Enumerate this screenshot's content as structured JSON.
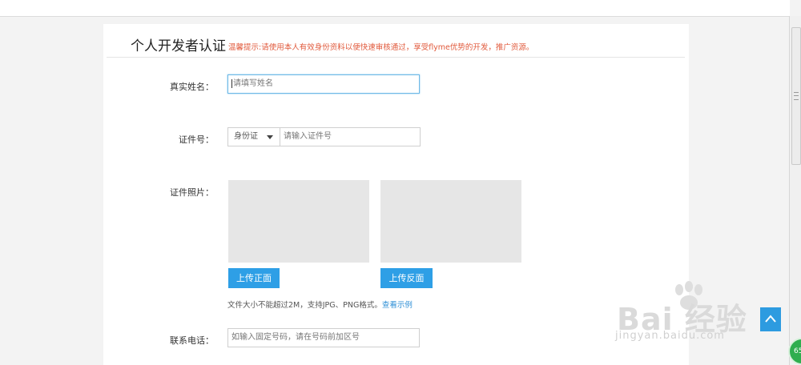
{
  "header": {
    "title": "个人开发者认证",
    "hint": "温馨提示:请使用本人有效身份资料以便快速审核通过，享受flyme优势的开发，推广资源。"
  },
  "form": {
    "name": {
      "label": "真实姓名：",
      "placeholder": "请填写姓名"
    },
    "id": {
      "label": "证件号：",
      "type_value": "身份证",
      "placeholder": "请输入证件号"
    },
    "photo": {
      "label": "证件照片：",
      "front_button": "上传正面",
      "back_button": "上传反面",
      "hint": "文件大小不能超过2M，支持JPG、PNG格式。",
      "example_link": "查看示例"
    },
    "phone": {
      "label": "联系电话：",
      "placeholder": "如输入固定号码，请在号码前加区号"
    }
  },
  "watermark": {
    "text": "Bai  经验",
    "url": "jingyan.baidu.com"
  },
  "badge": {
    "value": "65"
  },
  "colors": {
    "accent": "#2e9fe6",
    "hint": "#e15a3c",
    "photo_placeholder": "#e6e6e6"
  }
}
